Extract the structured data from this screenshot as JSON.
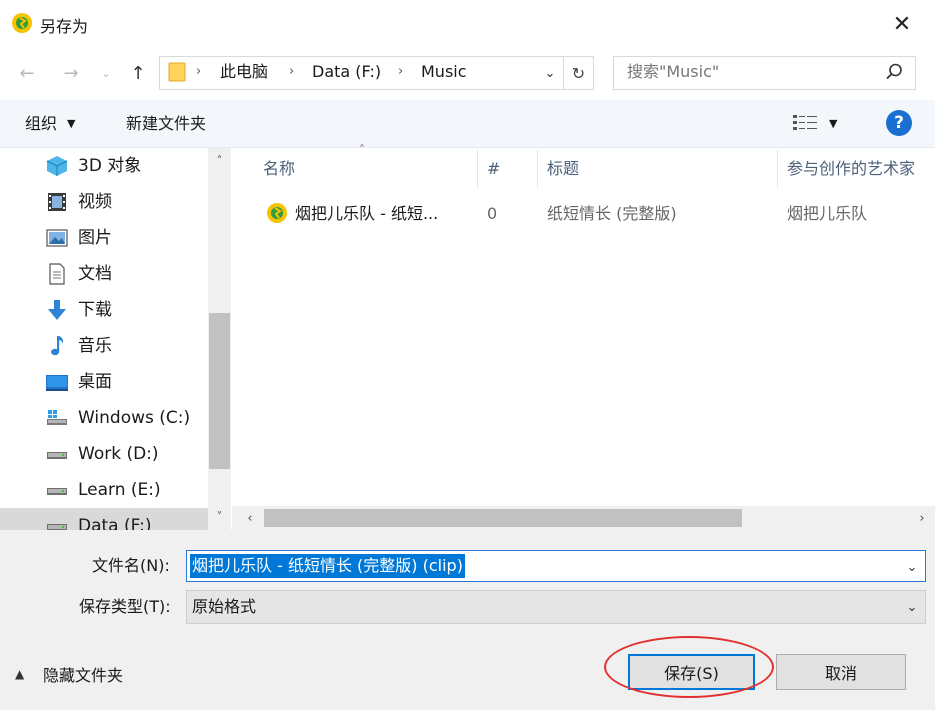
{
  "window": {
    "title": "另存为",
    "close_glyph": "✕"
  },
  "nav": {
    "back_glyph": "←",
    "forward_glyph": "→",
    "recent_glyph": "⌄",
    "up_glyph": "↑",
    "breadcrumbs": [
      "此电脑",
      "Data (F:)",
      "Music"
    ],
    "separator": "›",
    "dropdown_glyph": "⌄",
    "refresh_glyph": "↻"
  },
  "search": {
    "placeholder": "搜索\"Music\""
  },
  "toolbar": {
    "organize_label": "组织",
    "organize_caret": "▼",
    "new_folder_label": "新建文件夹",
    "view_caret": "▼",
    "help_glyph": "?"
  },
  "sidebar": {
    "items": [
      {
        "label": "3D 对象",
        "icon": "3d-objects-icon"
      },
      {
        "label": "视频",
        "icon": "video-icon"
      },
      {
        "label": "图片",
        "icon": "pictures-icon"
      },
      {
        "label": "文档",
        "icon": "documents-icon"
      },
      {
        "label": "下载",
        "icon": "downloads-icon"
      },
      {
        "label": "音乐",
        "icon": "music-icon"
      },
      {
        "label": "桌面",
        "icon": "desktop-icon"
      },
      {
        "label": "Windows (C:)",
        "icon": "system-drive-icon"
      },
      {
        "label": "Work (D:)",
        "icon": "drive-icon"
      },
      {
        "label": "Learn (E:)",
        "icon": "drive-icon"
      },
      {
        "label": "Data (F:)",
        "icon": "drive-icon"
      }
    ],
    "scroll_up": "˄",
    "scroll_down": "˅"
  },
  "file_list": {
    "columns": [
      "名称",
      "#",
      "标题",
      "参与创作的艺术家"
    ],
    "sort_caret": "˄",
    "rows": [
      {
        "name": "烟把儿乐队 - 纸短...",
        "number": "0",
        "title": "纸短情长 (完整版)",
        "artist": "烟把儿乐队"
      }
    ],
    "scroll_left": "‹",
    "scroll_right": "›"
  },
  "form": {
    "filename_label": "文件名(N):",
    "filename_value": "烟把儿乐队 - 纸短情长 (完整版) (clip)",
    "filetype_label": "保存类型(T):",
    "filetype_value": "原始格式",
    "dropdown_glyph": "⌄"
  },
  "footer": {
    "hide_folders_caret": "▲",
    "hide_folders_label": "隐藏文件夹",
    "save_label": "保存(S)",
    "cancel_label": "取消"
  },
  "colors": {
    "accent": "#0078d7",
    "annotation": "#e0302f",
    "help": "#1a6fd1"
  }
}
